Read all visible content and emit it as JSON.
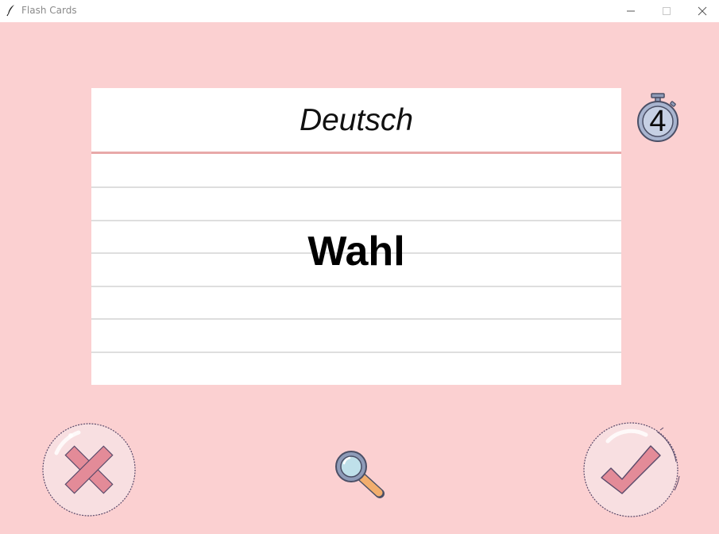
{
  "window": {
    "title": "Flash Cards",
    "icons": {
      "app": "feather-icon",
      "minimize": "minimize-icon",
      "maximize": "maximize-icon",
      "close": "close-icon"
    }
  },
  "card": {
    "language": "Deutsch",
    "word": "Wahl",
    "colors": {
      "background": "#ffffff",
      "header_rule": "#e8a9a9",
      "ruled_lines": "#dedede"
    }
  },
  "timer": {
    "icon": "stopwatch-icon",
    "value": "4"
  },
  "controls": {
    "wrong": {
      "icon": "cross-icon",
      "color": "#e38b98"
    },
    "flip": {
      "icon": "magnifying-glass-icon"
    },
    "right": {
      "icon": "checkmark-icon",
      "color": "#e38b98"
    }
  },
  "theme": {
    "background": "#fbd0d1"
  }
}
